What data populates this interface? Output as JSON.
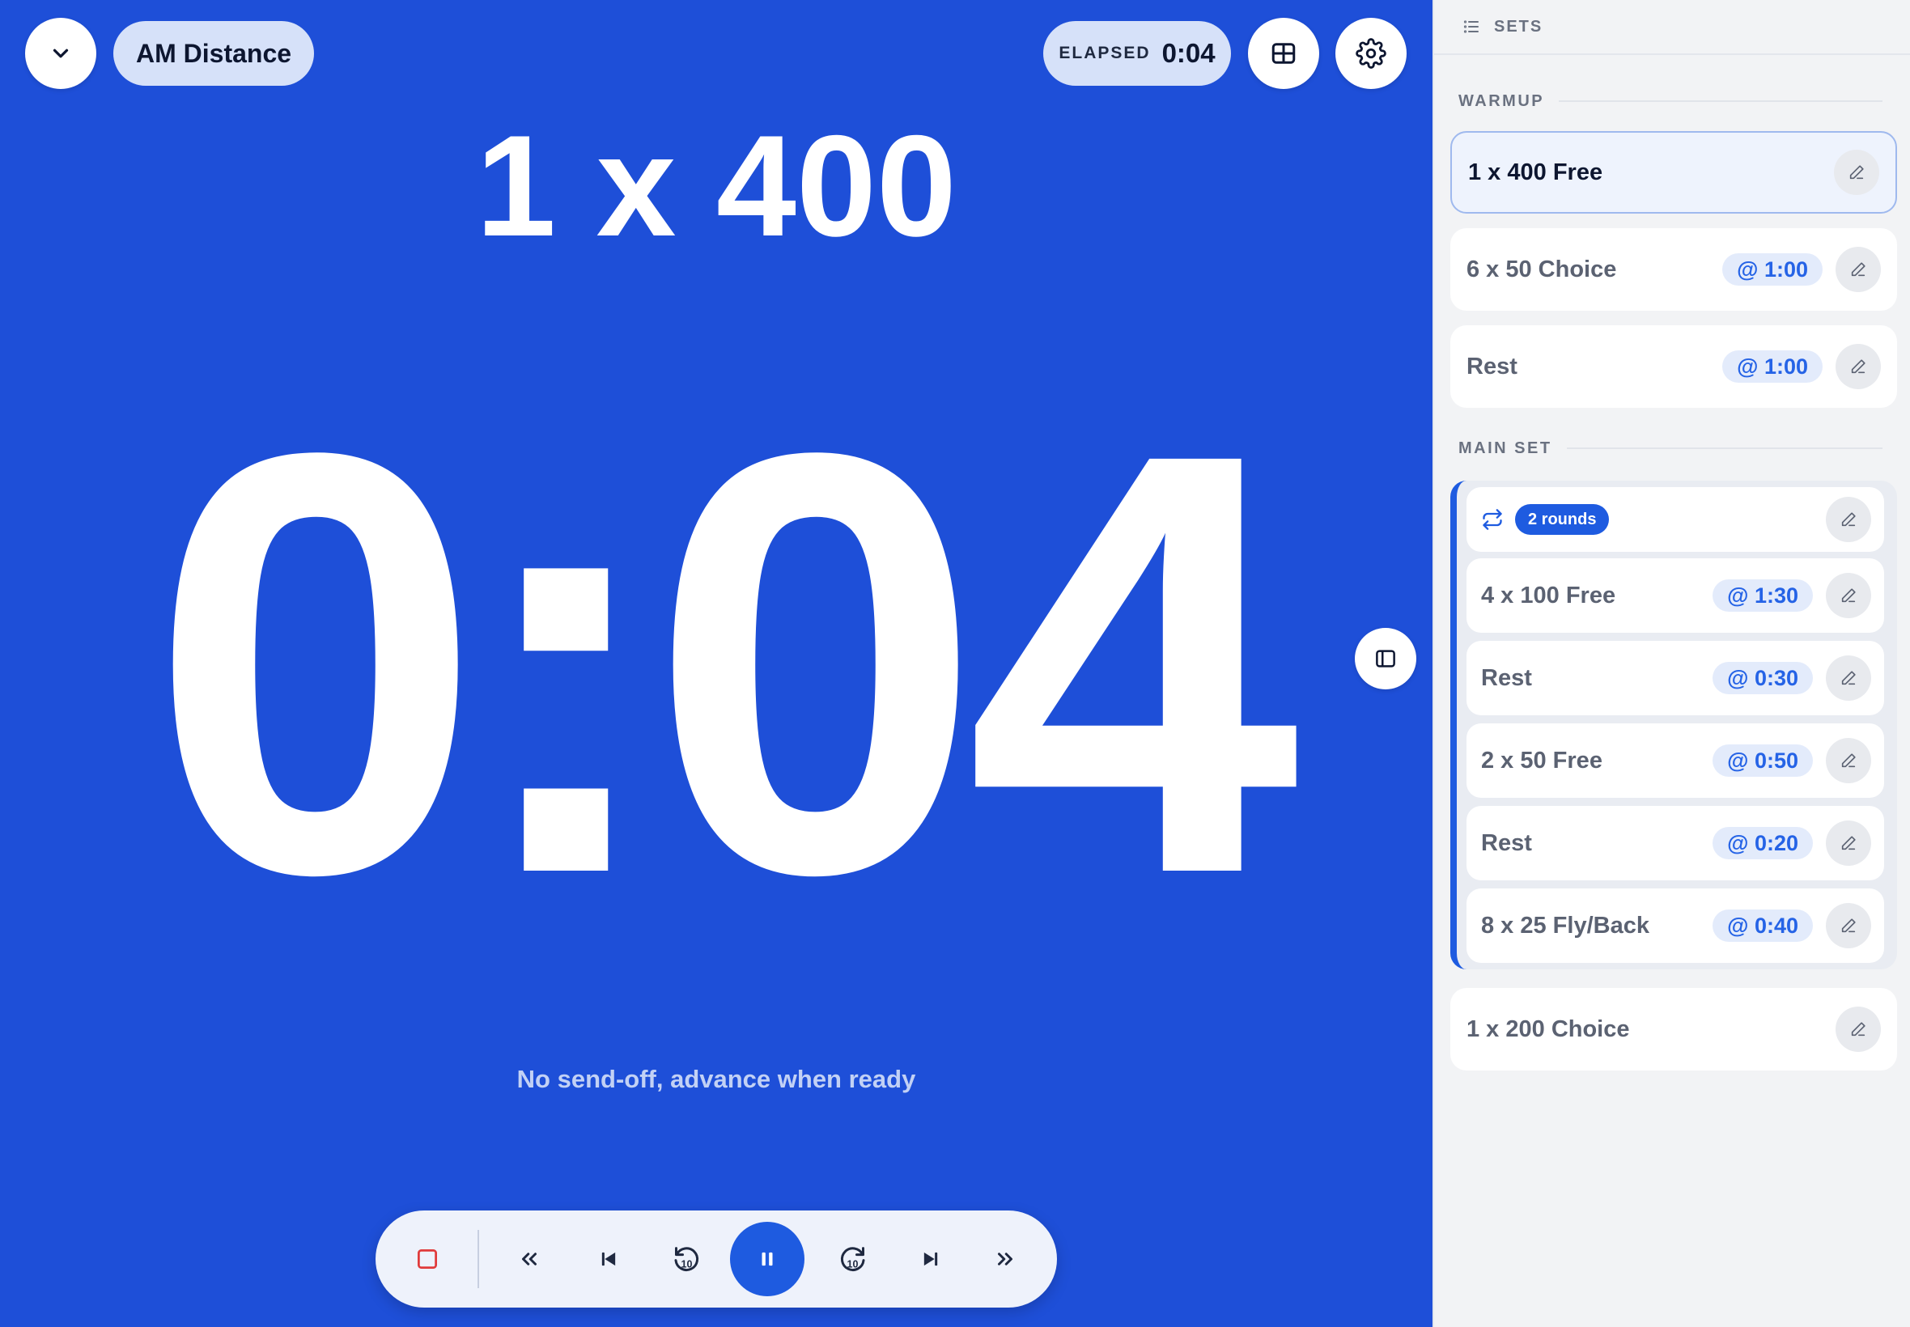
{
  "header": {
    "workout_name": "AM Distance",
    "elapsed_label": "ELAPSED",
    "elapsed_value": "0:04"
  },
  "main": {
    "current_set": "1 x 400",
    "timer": "0:04",
    "hint": "No send-off, advance when ready"
  },
  "controls": [
    {
      "name": "stop-button",
      "icon": "stop-icon"
    },
    {
      "name": "previous-set-button",
      "icon": "double-chevron-left-icon"
    },
    {
      "name": "skip-back-button",
      "icon": "skip-back-icon"
    },
    {
      "name": "rewind-10-button",
      "icon": "rewind-10-icon",
      "label": "10"
    },
    {
      "name": "pause-button",
      "icon": "pause-icon"
    },
    {
      "name": "forward-10-button",
      "icon": "forward-10-icon",
      "label": "10"
    },
    {
      "name": "skip-forward-button",
      "icon": "skip-forward-icon"
    },
    {
      "name": "next-set-button",
      "icon": "double-chevron-right-icon"
    }
  ],
  "sidebar": {
    "title": "SETS",
    "sections": [
      {
        "name": "WARMUP",
        "items": [
          {
            "label": "1 x 400 Free",
            "sendoff": "",
            "active": true
          },
          {
            "label": "6 x 50 Choice",
            "sendoff": "@ 1:00"
          },
          {
            "label": "Rest",
            "sendoff": "@ 1:00"
          }
        ]
      },
      {
        "name": "MAIN SET",
        "group": {
          "rounds": "2 rounds",
          "items": [
            {
              "label": "4 x 100 Free",
              "sendoff": "@ 1:30"
            },
            {
              "label": "Rest",
              "sendoff": "@ 0:30"
            },
            {
              "label": "2 x 50 Free",
              "sendoff": "@ 0:50"
            },
            {
              "label": "Rest",
              "sendoff": "@ 0:20"
            },
            {
              "label": "8 x 25 Fly/Back",
              "sendoff": "@ 0:40"
            }
          ]
        },
        "items_after": [
          {
            "label": "1 x 200 Choice",
            "sendoff": ""
          }
        ]
      }
    ]
  },
  "colors": {
    "primary_blue": "#1e4fd8",
    "accent_blue": "#1e5be0",
    "stop_red": "#e03b3b"
  }
}
